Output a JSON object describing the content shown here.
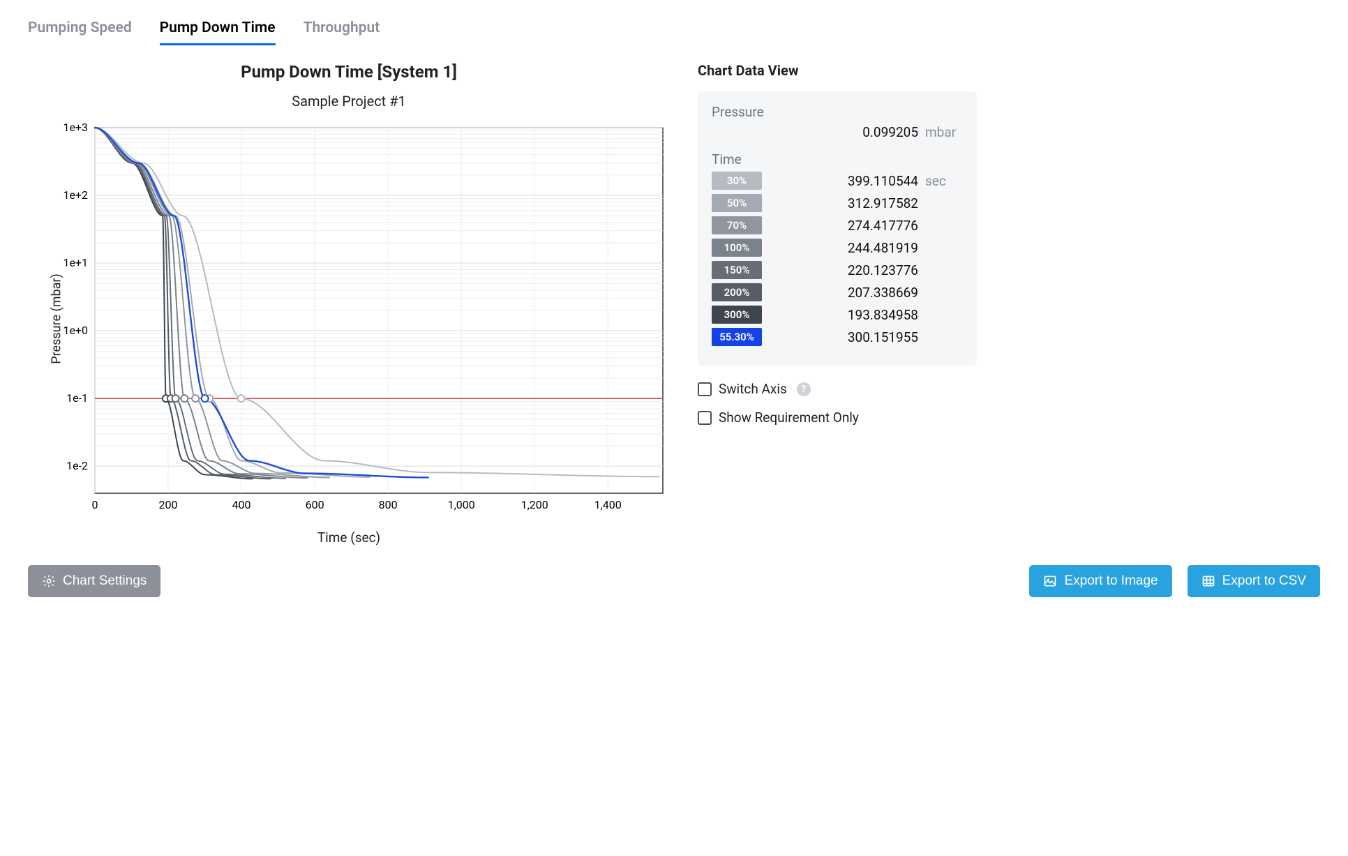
{
  "tabs": {
    "pumping_speed": "Pumping Speed",
    "pump_down_time": "Pump Down Time",
    "throughput": "Throughput"
  },
  "chart": {
    "title": "Pump Down Time [System 1]",
    "subtitle": "Sample Project #1",
    "xlabel": "Time (sec)",
    "ylabel": "Pressure (mbar)"
  },
  "side": {
    "title": "Chart Data View",
    "pressure_label": "Pressure",
    "pressure_value": "0.099205",
    "pressure_unit": "mbar",
    "time_label": "Time",
    "time_unit": "sec",
    "time_rows": [
      {
        "label": "30%",
        "value": "399.110544",
        "bg": "#b6bbc2"
      },
      {
        "label": "50%",
        "value": "312.917582",
        "bg": "#a4aab3"
      },
      {
        "label": "70%",
        "value": "274.417776",
        "bg": "#8f96a0"
      },
      {
        "label": "100%",
        "value": "244.481919",
        "bg": "#7b828c"
      },
      {
        "label": "150%",
        "value": "220.123776",
        "bg": "#676e78"
      },
      {
        "label": "200%",
        "value": "207.338669",
        "bg": "#565d66"
      },
      {
        "label": "300%",
        "value": "193.834958",
        "bg": "#3e454e"
      },
      {
        "label": "55.30%",
        "value": "300.151955",
        "bg": "#1542e6"
      }
    ],
    "switch_axis": "Switch Axis",
    "show_req_only": "Show Requirement Only"
  },
  "buttons": {
    "chart_settings": "Chart Settings",
    "export_image": "Export to Image",
    "export_csv": "Export to CSV"
  },
  "chart_data": {
    "type": "line",
    "title": "Pump Down Time [System 1]",
    "subtitle": "Sample Project #1",
    "xlabel": "Time (sec)",
    "ylabel": "Pressure (mbar)",
    "x_ticks": [
      0,
      200,
      400,
      600,
      800,
      1000,
      1200,
      1400
    ],
    "xlim": [
      0,
      1550
    ],
    "y_scale": "log",
    "y_ticks_exp": [
      -2,
      -1,
      0,
      1,
      2,
      3
    ],
    "ylim_exp": [
      -2.4,
      3
    ],
    "reference_line_y": 0.1,
    "marker_y": 0.1,
    "series": [
      {
        "name": "300%",
        "color": "#3e454e",
        "time_at_marker": 193.834958,
        "x_end": 430,
        "x50": 185,
        "asymptote_y": 0.0065
      },
      {
        "name": "200%",
        "color": "#565d66",
        "time_at_marker": 207.338669,
        "x_end": 480,
        "x50": 190,
        "asymptote_y": 0.0065
      },
      {
        "name": "150%",
        "color": "#676e78",
        "time_at_marker": 220.123776,
        "x_end": 520,
        "x50": 195,
        "asymptote_y": 0.0066
      },
      {
        "name": "100%",
        "color": "#7b828c",
        "time_at_marker": 244.481919,
        "x_end": 580,
        "x50": 202,
        "asymptote_y": 0.0067
      },
      {
        "name": "70%",
        "color": "#8f96a0",
        "time_at_marker": 274.417776,
        "x_end": 640,
        "x50": 210,
        "asymptote_y": 0.0068
      },
      {
        "name": "50%",
        "color": "#a4aab3",
        "time_at_marker": 312.917582,
        "x_end": 750,
        "x50": 220,
        "asymptote_y": 0.0069
      },
      {
        "name": "30%",
        "color": "#b6bbc2",
        "time_at_marker": 399.110544,
        "x_end": 1540,
        "x50": 240,
        "asymptote_y": 0.007
      },
      {
        "name": "55.30%",
        "color": "#1d4ed8",
        "time_at_marker": 300.151955,
        "x_end": 910,
        "x50": 216,
        "asymptote_y": 0.0068
      }
    ],
    "note": "All curves start at (x=0, y≈1000 mbar) and decay approximately exponentially toward an asymptotic floor near y≈0.0065 mbar. x50 is an approximate time where each curve passes ~50 mbar. Open-circle markers lie on each curve where it crosses y=0.1. Values are read/estimated from the rendered chart."
  }
}
